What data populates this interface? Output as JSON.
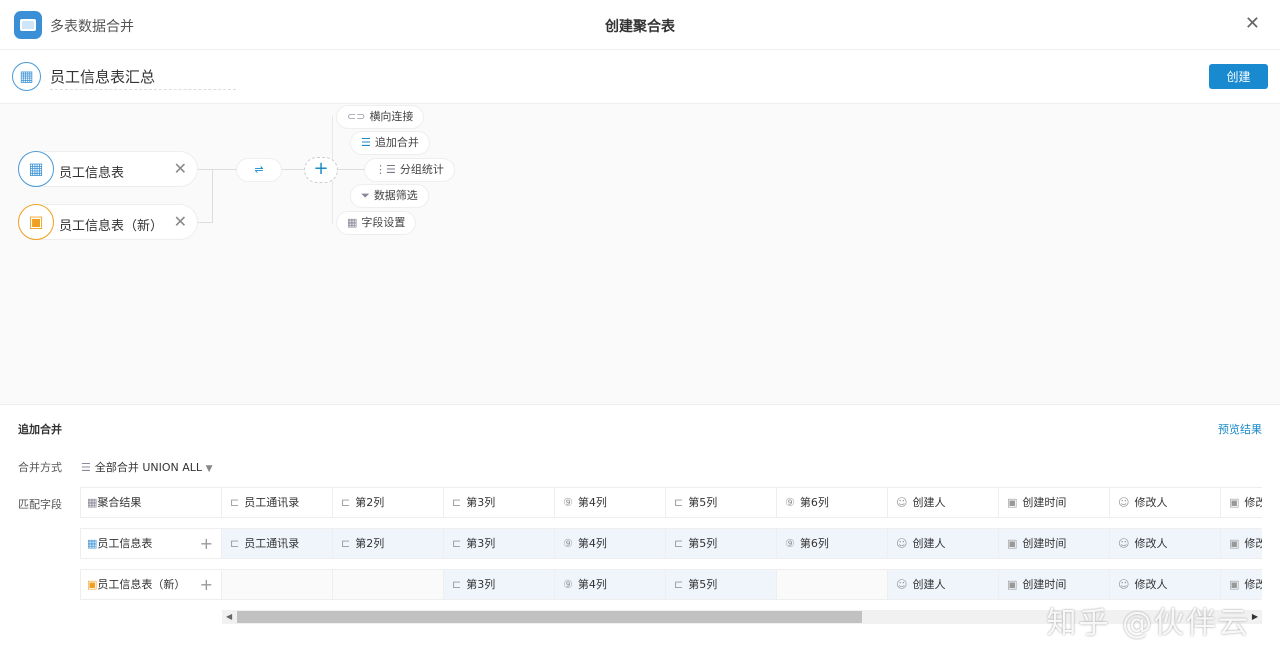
{
  "header": {
    "app_name": "多表数据合并",
    "title": "创建聚合表",
    "close": "✕"
  },
  "name_row": {
    "table_name": "员工信息表汇总",
    "create_label": "创建"
  },
  "canvas": {
    "sources": [
      {
        "label": "员工信息表",
        "remove": "✕",
        "color": "#4a9ad8"
      },
      {
        "label": "员工信息表（新）",
        "remove": "✕",
        "color": "#f0a020"
      }
    ],
    "merge_node": "⇌",
    "add_node": "+",
    "actions": [
      {
        "label": "横向连接",
        "icon": "⊂⊃"
      },
      {
        "label": "追加合并",
        "icon": "☰"
      },
      {
        "label": "分组统计",
        "icon": "⋮☰"
      },
      {
        "label": "数据筛选",
        "icon": "⏷"
      },
      {
        "label": "字段设置",
        "icon": "▦"
      }
    ]
  },
  "panel": {
    "section_title": "追加合并",
    "preview": "预览结果",
    "merge_mode_label": "合并方式",
    "merge_mode_value": "全部合并 UNION ALL",
    "match_label": "匹配字段",
    "rows": [
      {
        "name": "聚合结果",
        "cells": [
          [
            "⊏",
            "员工通讯录"
          ],
          [
            "⊏",
            "第2列"
          ],
          [
            "⊏",
            "第3列"
          ],
          [
            "⑨",
            "第4列"
          ],
          [
            "⊏",
            "第5列"
          ],
          [
            "⑨",
            "第6列"
          ],
          [
            "☺",
            "创建人"
          ],
          [
            "▣",
            "创建时间"
          ],
          [
            "☺",
            "修改人"
          ],
          [
            "▣",
            "修改时间"
          ]
        ]
      },
      {
        "name": "员工信息表",
        "cells": [
          [
            "⊏",
            "员工通讯录"
          ],
          [
            "⊏",
            "第2列"
          ],
          [
            "⊏",
            "第3列"
          ],
          [
            "⑨",
            "第4列"
          ],
          [
            "⊏",
            "第5列"
          ],
          [
            "⑨",
            "第6列"
          ],
          [
            "☺",
            "创建人"
          ],
          [
            "▣",
            "创建时间"
          ],
          [
            "☺",
            "修改人"
          ],
          [
            "▣",
            "修改时间"
          ]
        ]
      },
      {
        "name": "员工信息表（新）",
        "cells": [
          null,
          null,
          [
            "⊏",
            "第3列"
          ],
          [
            "⑨",
            "第4列"
          ],
          [
            "⊏",
            "第5列"
          ],
          null,
          [
            "☺",
            "创建人"
          ],
          [
            "▣",
            "创建时间"
          ],
          [
            "☺",
            "修改人"
          ],
          [
            "▣",
            "修改时间"
          ]
        ]
      }
    ]
  },
  "watermark": "知乎 @伙伴云"
}
